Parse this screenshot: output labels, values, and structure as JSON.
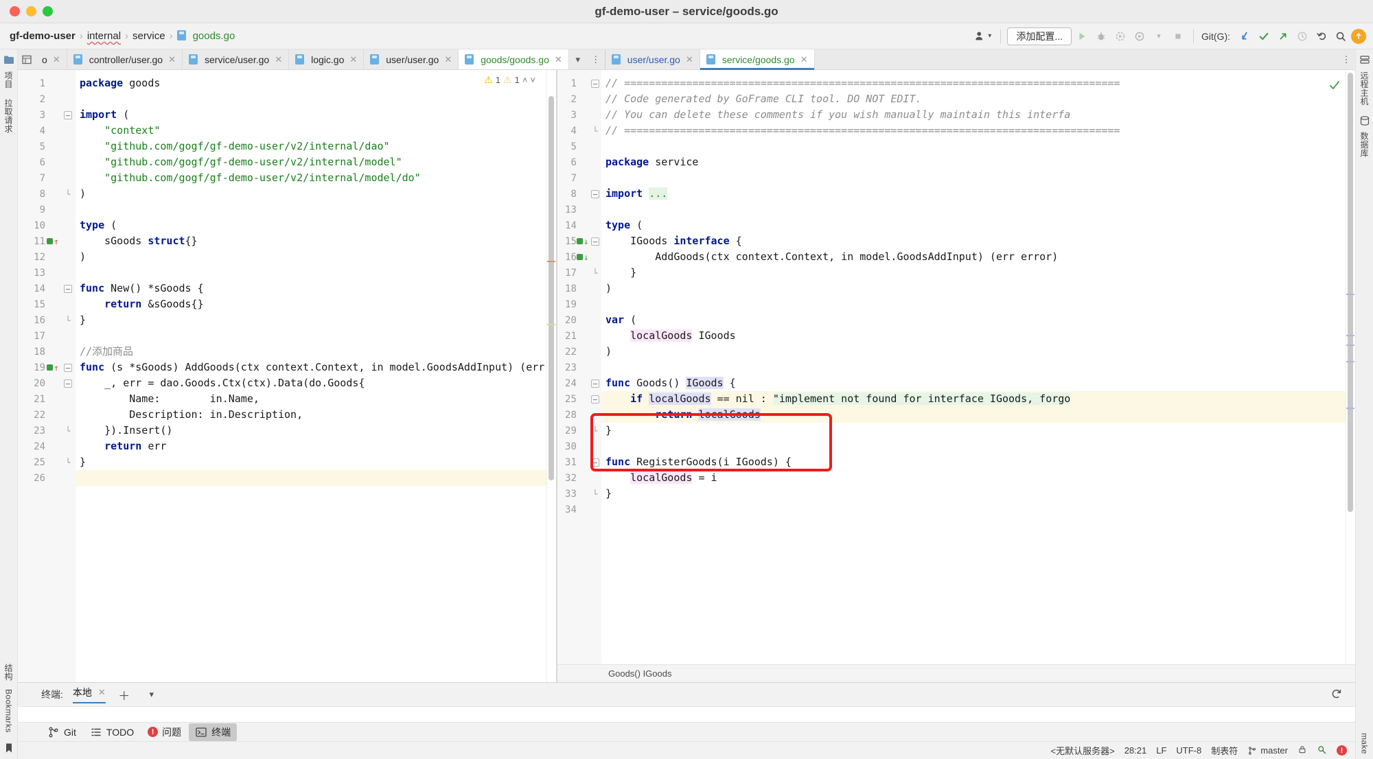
{
  "window": {
    "title": "gf-demo-user – service/goods.go",
    "traffic_lights": [
      "close",
      "minimize",
      "zoom"
    ]
  },
  "breadcrumb": {
    "items": [
      {
        "label": "gf-demo-user",
        "style": "bold"
      },
      {
        "label": "internal",
        "style": "wavy"
      },
      {
        "label": "service",
        "style": "plain"
      },
      {
        "label": "goods.go",
        "style": "file"
      }
    ],
    "separator": "›"
  },
  "toolbar": {
    "profile_icon": "user-dropdown-icon",
    "add_config_label": "添加配置...",
    "run_icon": "run-icon",
    "debug_icon": "debug-icon",
    "coverage_icon": "run-with-coverage-icon",
    "profiler_icon": "run-profiler-icon",
    "dropdown_icon": "chevron-down-icon",
    "stop_icon": "stop-icon",
    "git_label": "Git(G):",
    "update_icon": "git-update-icon",
    "commit_icon": "git-commit-icon",
    "push_icon": "git-push-icon",
    "history_icon": "git-history-icon",
    "rollback_icon": "git-rollback-icon",
    "search_icon": "search-icon",
    "notification_icon": "notification-icon"
  },
  "editor_tabs_left": [
    {
      "label": "o",
      "icon": "go-file-icon",
      "color": "plain",
      "active": false,
      "truncated": true
    },
    {
      "label": "controller/user.go",
      "icon": "go-file-icon",
      "color": "plain",
      "active": false
    },
    {
      "label": "service/user.go",
      "icon": "go-file-icon",
      "color": "plain",
      "active": false
    },
    {
      "label": "logic.go",
      "icon": "go-file-icon",
      "color": "plain",
      "active": false
    },
    {
      "label": "user/user.go",
      "icon": "go-file-icon",
      "color": "plain",
      "active": false
    },
    {
      "label": "goods/goods.go",
      "icon": "go-file-icon",
      "color": "green",
      "active": true
    }
  ],
  "tab_controls": {
    "chevron": "chevron-down-icon",
    "more": "more-options-icon"
  },
  "editor_tabs_right": [
    {
      "label": "user/user.go",
      "icon": "go-file-icon",
      "color": "blue",
      "active": false
    },
    {
      "label": "service/goods.go",
      "icon": "go-file-icon",
      "color": "green",
      "active": true
    }
  ],
  "left_pane": {
    "inspection": {
      "warn_count_1": "1",
      "warn_count_2": "1",
      "up": "˄",
      "down": "˅"
    },
    "lines": [
      {
        "n": "1",
        "marker": null,
        "fold": "start-none",
        "tokens": [
          {
            "t": "package ",
            "c": "kw"
          },
          {
            "t": "goods",
            "c": ""
          }
        ]
      },
      {
        "n": "2",
        "marker": null,
        "fold": null,
        "tokens": []
      },
      {
        "n": "3",
        "marker": null,
        "fold": "open",
        "tokens": [
          {
            "t": "import",
            "c": "kw"
          },
          {
            "t": " (",
            "c": ""
          }
        ]
      },
      {
        "n": "4",
        "marker": null,
        "fold": null,
        "tokens": [
          {
            "t": "    \"context\"",
            "c": "str"
          }
        ]
      },
      {
        "n": "5",
        "marker": null,
        "fold": null,
        "tokens": [
          {
            "t": "    \"github.com/gogf/gf-demo-user/v2/internal/dao\"",
            "c": "str"
          }
        ]
      },
      {
        "n": "6",
        "marker": null,
        "fold": null,
        "tokens": [
          {
            "t": "    \"github.com/gogf/gf-demo-user/v2/internal/model\"",
            "c": "str"
          }
        ]
      },
      {
        "n": "7",
        "marker": null,
        "fold": null,
        "tokens": [
          {
            "t": "    \"github.com/gogf/gf-demo-user/v2/internal/model/do\"",
            "c": "str"
          }
        ]
      },
      {
        "n": "8",
        "marker": null,
        "fold": "end",
        "tokens": [
          {
            "t": ")",
            "c": ""
          }
        ]
      },
      {
        "n": "9",
        "marker": null,
        "fold": null,
        "tokens": []
      },
      {
        "n": "10",
        "marker": null,
        "fold": null,
        "tokens": [
          {
            "t": "type",
            "c": "kw"
          },
          {
            "t": " (",
            "c": ""
          }
        ]
      },
      {
        "n": "11",
        "marker": "impl-up",
        "fold": null,
        "tokens": [
          {
            "t": "    sGoods ",
            "c": ""
          },
          {
            "t": "struct",
            "c": "kw"
          },
          {
            "t": "{}",
            "c": ""
          }
        ]
      },
      {
        "n": "12",
        "marker": null,
        "fold": null,
        "tokens": [
          {
            "t": ")",
            "c": ""
          }
        ]
      },
      {
        "n": "13",
        "marker": null,
        "fold": null,
        "tokens": []
      },
      {
        "n": "14",
        "marker": null,
        "fold": "open",
        "tokens": [
          {
            "t": "func",
            "c": "kw"
          },
          {
            "t": " New() *sGoods {",
            "c": ""
          }
        ]
      },
      {
        "n": "15",
        "marker": null,
        "fold": null,
        "tokens": [
          {
            "t": "    ",
            "c": ""
          },
          {
            "t": "return",
            "c": "kw"
          },
          {
            "t": " &sGoods{}",
            "c": ""
          }
        ]
      },
      {
        "n": "16",
        "marker": null,
        "fold": "end",
        "tokens": [
          {
            "t": "}",
            "c": ""
          }
        ]
      },
      {
        "n": "17",
        "marker": null,
        "fold": null,
        "tokens": []
      },
      {
        "n": "18",
        "marker": null,
        "fold": null,
        "tokens": [
          {
            "t": "//添加商品",
            "c": "cmt-plain"
          }
        ]
      },
      {
        "n": "19",
        "marker": "impl-up",
        "fold": "open",
        "tokens": [
          {
            "t": "func",
            "c": "kw"
          },
          {
            "t": " (s *sGoods) AddGoods(ctx context.Context, in model.GoodsAddInput) (err",
            "c": ""
          }
        ]
      },
      {
        "n": "20",
        "marker": null,
        "fold": "open",
        "tokens": [
          {
            "t": "    _, err = dao.Goods.Ctx(ctx).Data(do.Goods{",
            "c": ""
          }
        ]
      },
      {
        "n": "21",
        "marker": null,
        "fold": null,
        "tokens": [
          {
            "t": "        Name:        in.Name,",
            "c": ""
          }
        ]
      },
      {
        "n": "22",
        "marker": null,
        "fold": null,
        "tokens": [
          {
            "t": "        Description: in.Description,",
            "c": ""
          }
        ]
      },
      {
        "n": "23",
        "marker": null,
        "fold": "end",
        "tokens": [
          {
            "t": "    }).Insert()",
            "c": ""
          }
        ]
      },
      {
        "n": "24",
        "marker": null,
        "fold": null,
        "tokens": [
          {
            "t": "    ",
            "c": ""
          },
          {
            "t": "return",
            "c": "kw"
          },
          {
            "t": " err",
            "c": ""
          }
        ]
      },
      {
        "n": "25",
        "marker": null,
        "fold": "end",
        "tokens": [
          {
            "t": "}",
            "c": ""
          }
        ]
      },
      {
        "n": "26",
        "marker": null,
        "fold": null,
        "highlight": true,
        "tokens": []
      }
    ]
  },
  "right_pane": {
    "lines": [
      {
        "n": "1",
        "marker": null,
        "fold": "open",
        "tokens": [
          {
            "t": "// ================================================================================",
            "c": "cmt"
          }
        ]
      },
      {
        "n": "2",
        "marker": null,
        "fold": null,
        "tokens": [
          {
            "t": "// Code generated by GoFrame CLI tool. DO NOT EDIT.",
            "c": "cmt"
          }
        ]
      },
      {
        "n": "3",
        "marker": null,
        "fold": null,
        "tokens": [
          {
            "t": "// You can delete these comments if you wish manually maintain this interfa",
            "c": "cmt"
          }
        ]
      },
      {
        "n": "4",
        "marker": null,
        "fold": "end",
        "tokens": [
          {
            "t": "// ================================================================================",
            "c": "cmt"
          }
        ]
      },
      {
        "n": "5",
        "marker": null,
        "fold": null,
        "tokens": []
      },
      {
        "n": "6",
        "marker": null,
        "fold": null,
        "tokens": [
          {
            "t": "package",
            "c": "kw"
          },
          {
            "t": " service",
            "c": ""
          }
        ]
      },
      {
        "n": "7",
        "marker": null,
        "fold": null,
        "tokens": []
      },
      {
        "n": "8",
        "marker": null,
        "fold": "open",
        "tokens": [
          {
            "t": "import",
            "c": "kw"
          },
          {
            "t": " ",
            "c": ""
          },
          {
            "t": "...",
            "c": "ellip"
          }
        ]
      },
      {
        "n": "13",
        "marker": null,
        "fold": null,
        "tokens": []
      },
      {
        "n": "14",
        "marker": null,
        "fold": null,
        "tokens": [
          {
            "t": "type",
            "c": "kw"
          },
          {
            "t": " (",
            "c": ""
          }
        ]
      },
      {
        "n": "15",
        "marker": "impl-dn",
        "fold": "open",
        "tokens": [
          {
            "t": "    IGoods ",
            "c": ""
          },
          {
            "t": "interface",
            "c": "kw"
          },
          {
            "t": " {",
            "c": ""
          }
        ]
      },
      {
        "n": "16",
        "marker": "impl-dn",
        "fold": null,
        "tokens": [
          {
            "t": "        AddGoods(ctx context.Context, in model.GoodsAddInput) (err error)",
            "c": ""
          }
        ]
      },
      {
        "n": "17",
        "marker": null,
        "fold": "end",
        "tokens": [
          {
            "t": "    }",
            "c": ""
          }
        ]
      },
      {
        "n": "18",
        "marker": null,
        "fold": null,
        "tokens": [
          {
            "t": ")",
            "c": ""
          }
        ]
      },
      {
        "n": "19",
        "marker": null,
        "fold": null,
        "tokens": []
      },
      {
        "n": "20",
        "marker": null,
        "fold": null,
        "tokens": [
          {
            "t": "var",
            "c": "kw"
          },
          {
            "t": " (",
            "c": ""
          }
        ]
      },
      {
        "n": "21",
        "marker": null,
        "fold": null,
        "tokens": [
          {
            "t": "    ",
            "c": ""
          },
          {
            "t": "localGoods",
            "c": "pink"
          },
          {
            "t": " IGoods",
            "c": ""
          }
        ]
      },
      {
        "n": "22",
        "marker": null,
        "fold": null,
        "tokens": [
          {
            "t": ")",
            "c": ""
          }
        ]
      },
      {
        "n": "23",
        "marker": null,
        "fold": null,
        "tokens": []
      },
      {
        "n": "24",
        "marker": null,
        "fold": "open",
        "tokens": [
          {
            "t": "func",
            "c": "kw"
          },
          {
            "t": " Goods() ",
            "c": ""
          },
          {
            "t": "IGoods",
            "c": "lav"
          },
          {
            "t": " {",
            "c": ""
          }
        ]
      },
      {
        "n": "25",
        "marker": null,
        "fold": "open",
        "highlight": true,
        "tokens": [
          {
            "t": "    ",
            "c": ""
          },
          {
            "t": "if",
            "c": "kw"
          },
          {
            "t": " ",
            "c": ""
          },
          {
            "t": "localGoods",
            "c": "lav"
          },
          {
            "t": " == nil : ",
            "c": ""
          },
          {
            "t": "\"implement not found for interface IGoods, forgo",
            "c": "grn"
          }
        ]
      },
      {
        "n": "28",
        "marker": null,
        "fold": null,
        "highlight": true,
        "tokens": [
          {
            "t": "        ",
            "c": ""
          },
          {
            "t": "return",
            "c": "kw"
          },
          {
            "t": " ",
            "c": ""
          },
          {
            "t": "localGoods",
            "c": "lav"
          }
        ]
      },
      {
        "n": "29",
        "marker": null,
        "fold": "end",
        "tokens": [
          {
            "t": "}",
            "c": ""
          }
        ]
      },
      {
        "n": "30",
        "marker": null,
        "fold": null,
        "tokens": []
      },
      {
        "n": "31",
        "marker": null,
        "fold": "open",
        "tokens": [
          {
            "t": "func",
            "c": "kw"
          },
          {
            "t": " RegisterGoods(i IGoods) {",
            "c": ""
          }
        ]
      },
      {
        "n": "32",
        "marker": null,
        "fold": null,
        "tokens": [
          {
            "t": "    ",
            "c": ""
          },
          {
            "t": "localGoods",
            "c": "pink"
          },
          {
            "t": " = i",
            "c": ""
          }
        ]
      },
      {
        "n": "33",
        "marker": null,
        "fold": "end",
        "tokens": [
          {
            "t": "}",
            "c": ""
          }
        ]
      },
      {
        "n": "34",
        "marker": null,
        "fold": null,
        "tokens": []
      }
    ],
    "breadcrumb": "Goods() IGoods",
    "annotation": {
      "color": "#ef1b1b",
      "target": "RegisterGoods function"
    }
  },
  "left_stripe": {
    "top_icons": [
      "project-icon"
    ],
    "items": [
      {
        "label": "项目",
        "name": "project"
      },
      {
        "label": "拉取请求",
        "name": "pull-requests"
      }
    ],
    "bottom_items": [
      {
        "label": "结构",
        "name": "structure"
      },
      {
        "label": "Bookmarks",
        "name": "bookmarks"
      }
    ]
  },
  "right_stripe": {
    "items": [
      {
        "label": "远程主机",
        "name": "remote-host"
      },
      {
        "label": "数据库",
        "name": "database"
      }
    ],
    "bottom_items": [
      {
        "label": "make",
        "name": "make"
      }
    ]
  },
  "terminal": {
    "label": "终端:",
    "tab": "本地",
    "close_icon": "close-icon",
    "add_icon": "plus-icon",
    "chevron_icon": "chevron-down-icon",
    "collapse_icon": "collapse-icon"
  },
  "bottom_tabs": [
    {
      "label": "Git",
      "icon": "git-branch-icon",
      "selected": false
    },
    {
      "label": "TODO",
      "icon": "todo-icon",
      "selected": false
    },
    {
      "label": "问题",
      "icon": "problems-icon",
      "selected": false
    },
    {
      "label": "终端",
      "icon": "terminal-icon",
      "selected": true
    }
  ],
  "statusbar": {
    "server": "<无默认服务器>",
    "caret": "28:21",
    "line_sep": "LF",
    "encoding": "UTF-8",
    "indent": "制表符",
    "branch": "master",
    "branch_icon": "git-branch-icon",
    "lock_icon": "lock-icon",
    "inspect_icon": "inspection-icon",
    "error_icon": "error-icon"
  }
}
